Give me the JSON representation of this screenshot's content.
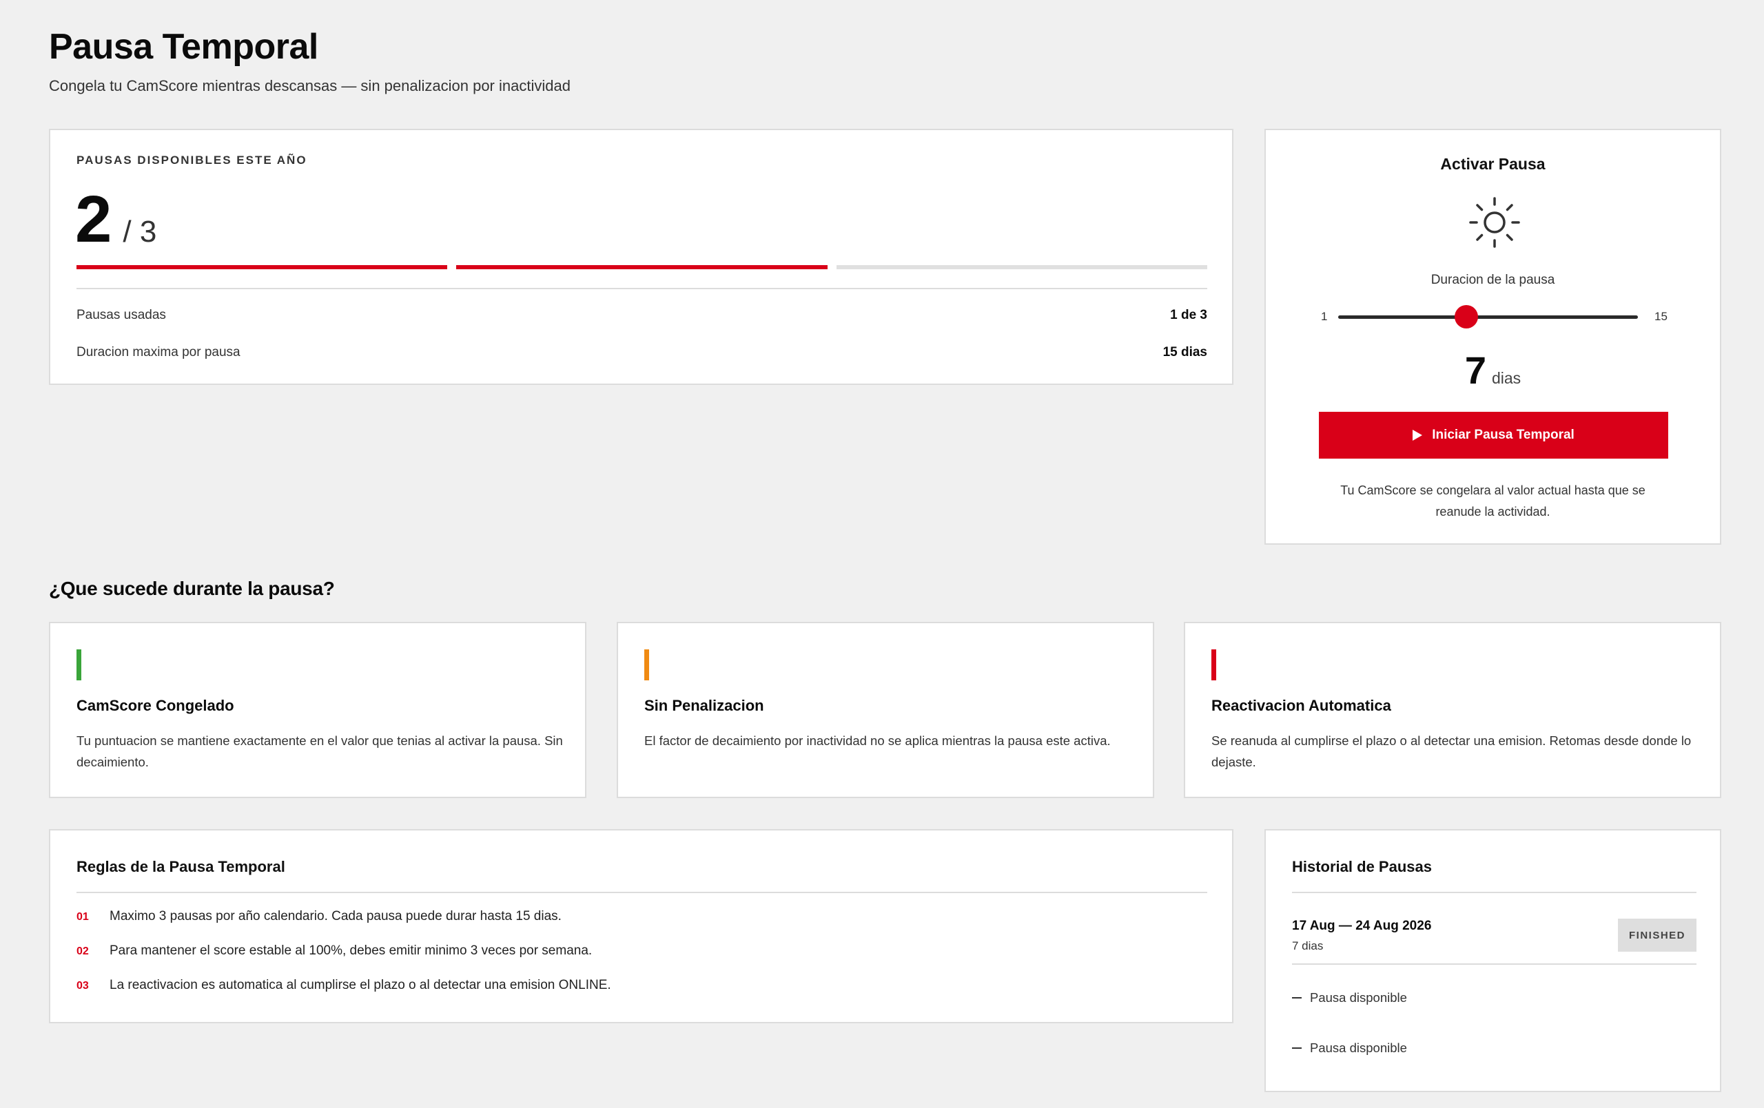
{
  "header": {
    "title": "Pausa Temporal",
    "subtitle": "Congela tu CamScore mientras descansas — sin penalizacion por inactividad"
  },
  "availability": {
    "label": "PAUSAS DISPONIBLES ESTE AÑO",
    "available": "2",
    "total": "/ 3",
    "bars_filled": 2,
    "bars_total": 3,
    "accent_color": "#d90018",
    "stats": [
      {
        "label": "Pausas usadas",
        "value": "1 de 3"
      },
      {
        "label": "Duracion maxima por pausa",
        "value": "15 dias"
      }
    ]
  },
  "activate": {
    "title": "Activar Pausa",
    "icon": "sun-icon",
    "duration_label": "Duracion de la pausa",
    "slider_min": "1",
    "slider_max": "15",
    "slider_value": 7,
    "value_display": "7",
    "value_unit": "dias",
    "button_icon": "play-icon",
    "button_label": "Iniciar Pausa Temporal",
    "note": "Tu CamScore se congelara al valor actual hasta que se reanude la actividad."
  },
  "features": {
    "section_title": "¿Que sucede durante la pausa?",
    "items": [
      {
        "title": "CamScore Congelado",
        "description": "Tu puntuacion se mantiene exactamente en el valor que tenias al activar la pausa. Sin decaimiento.",
        "accent": "#3aa53a"
      },
      {
        "title": "Sin Penalizacion",
        "description": "El factor de decaimiento por inactividad no se aplica mientras la pausa este activa.",
        "accent": "#f08a12"
      },
      {
        "title": "Reactivacion Automatica",
        "description": "Se reanuda al cumplirse el plazo o al detectar una emision. Retomas desde donde lo dejaste.",
        "accent": "#d90018"
      }
    ]
  },
  "rules": {
    "title": "Reglas de la Pausa Temporal",
    "items": [
      {
        "num": "01",
        "text": "Maximo 3 pausas por año calendario. Cada pausa puede durar hasta 15 dias."
      },
      {
        "num": "02",
        "text": "Para mantener el score estable al 100%, debes emitir minimo 3 veces por semana."
      },
      {
        "num": "03",
        "text": "La reactivacion es automatica al cumplirse el plazo o al detectar una emision ONLINE."
      }
    ]
  },
  "history": {
    "title": "Historial de Pausas",
    "entries": [
      {
        "range": "17 Aug — 24 Aug 2026",
        "days": "7 dias",
        "status": "FINISHED"
      }
    ],
    "available_slots": [
      "Pausa disponible",
      "Pausa disponible"
    ]
  }
}
